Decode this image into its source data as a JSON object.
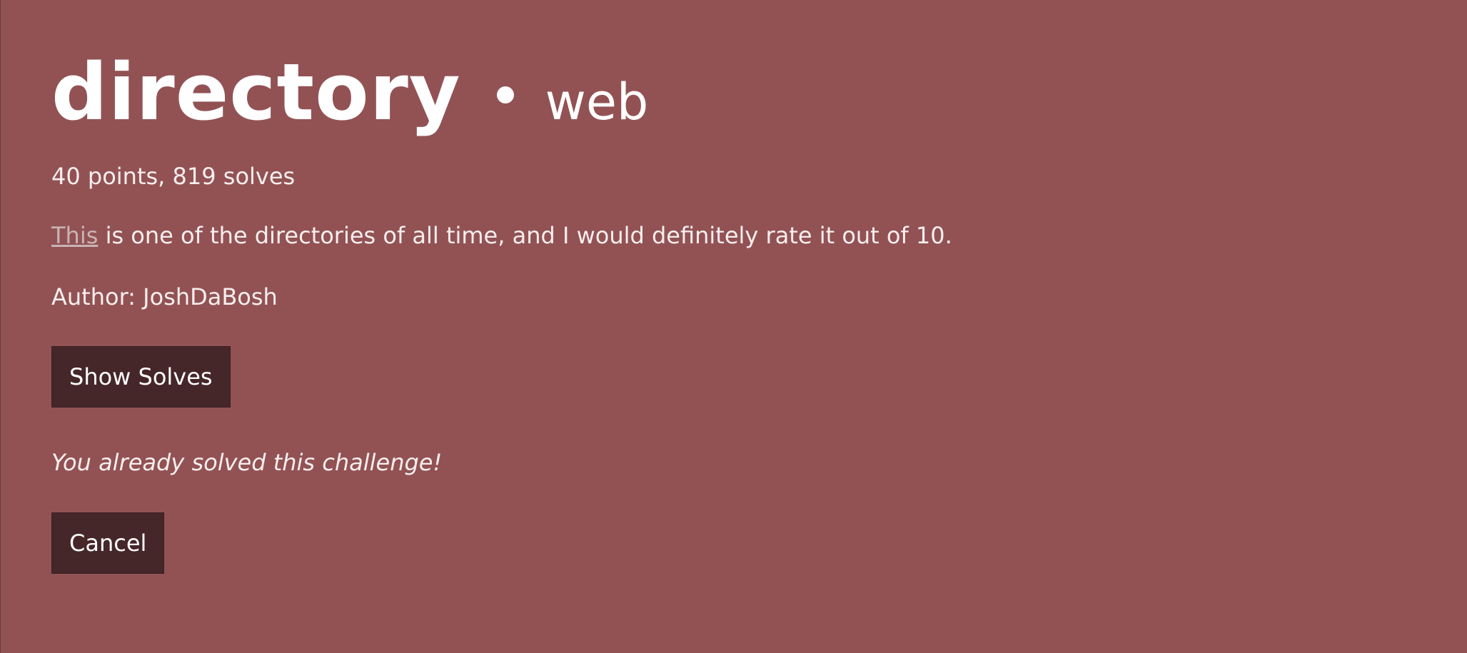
{
  "challenge": {
    "name": "directory",
    "category": "web",
    "stats": "40 points, 819 solves",
    "description": {
      "link_text": "This",
      "rest": " is one of the directories of all time, and I would definitely rate it out of 10."
    },
    "author": "Author: JoshDaBosh"
  },
  "buttons": {
    "show_solves": "Show Solves",
    "cancel": "Cancel"
  },
  "status_message": "You already solved this challenge!",
  "colors": {
    "background": "#925254",
    "button_bg": "#452629",
    "text": "#f7eeee",
    "link": "#c9b3b3"
  }
}
